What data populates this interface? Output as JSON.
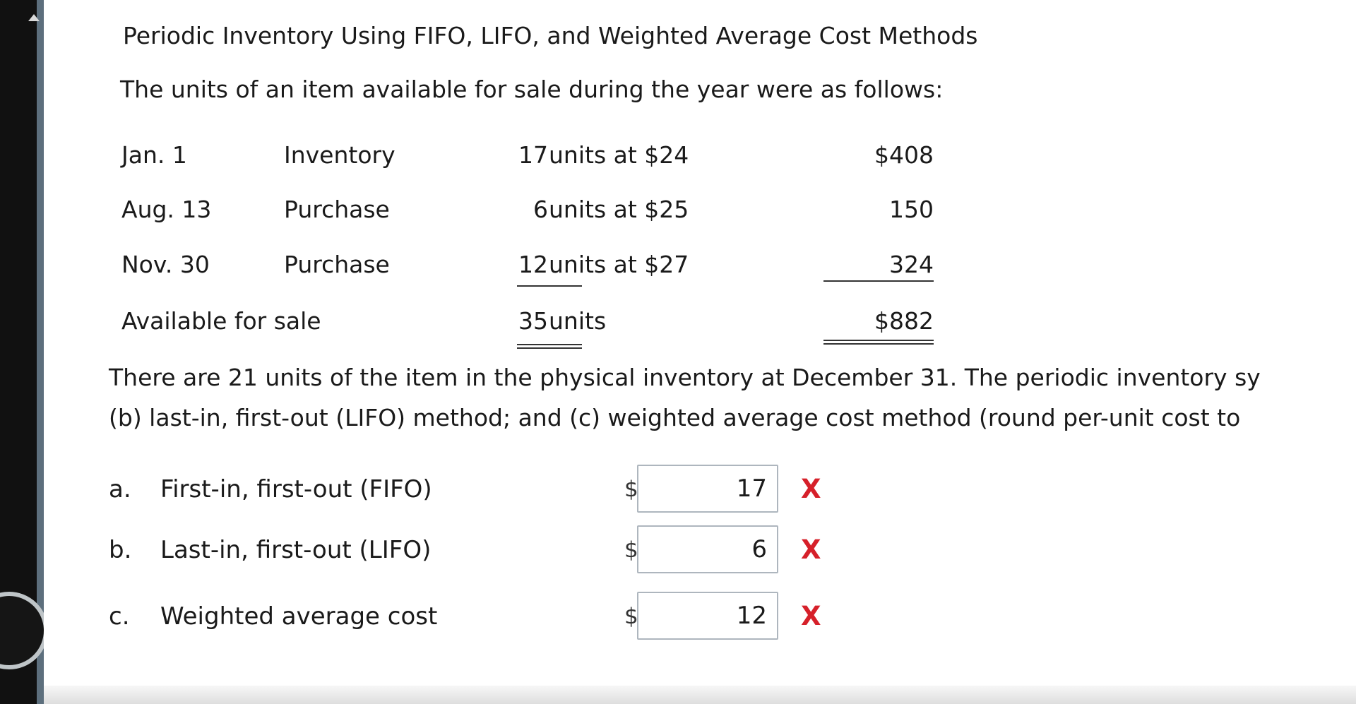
{
  "problem": {
    "title": "Periodic Inventory Using FIFO, LIFO, and Weighted Average Cost Methods",
    "intro": "The units of an item available for sale during the year were as follows:",
    "inventory_rows": [
      {
        "date": "Jan. 1",
        "description": "Inventory",
        "quantity": "17",
        "unit_text": "units at $24",
        "cost": "$408"
      },
      {
        "date": "Aug. 13",
        "description": "Purchase",
        "quantity": "6",
        "unit_text": "units at $25",
        "cost": "150"
      },
      {
        "date": "Nov. 30",
        "description": "Purchase",
        "quantity": "12",
        "unit_text": "units at $27",
        "cost": "324"
      },
      {
        "date": "Available for sale",
        "description": "",
        "quantity": "35",
        "unit_text": "units",
        "cost": "$882"
      }
    ],
    "statement_line_1": "There are 21 units of the item in the physical inventory at December 31. The periodic inventory sy",
    "statement_line_2": "(b) last-in, first-out (LIFO) method; and (c) weighted average cost method (round per-unit cost to"
  },
  "answers": [
    {
      "letter": "a.",
      "label": "First-in, first-out (FIFO)",
      "currency": "$",
      "value": "17",
      "status": "X"
    },
    {
      "letter": "b.",
      "label": "Last-in, first-out (LIFO)",
      "currency": "$",
      "value": "6",
      "status": "X"
    },
    {
      "letter": "c.",
      "label": "Weighted average cost",
      "currency": "$",
      "value": "12",
      "status": "X"
    }
  ],
  "colors": {
    "error": "#d6202a",
    "input_border": "#aeb6be",
    "sidebar": "#111111"
  },
  "icons": {
    "sidebar_arrow": "up-arrow-icon",
    "incorrect_mark": "x-mark-icon"
  }
}
